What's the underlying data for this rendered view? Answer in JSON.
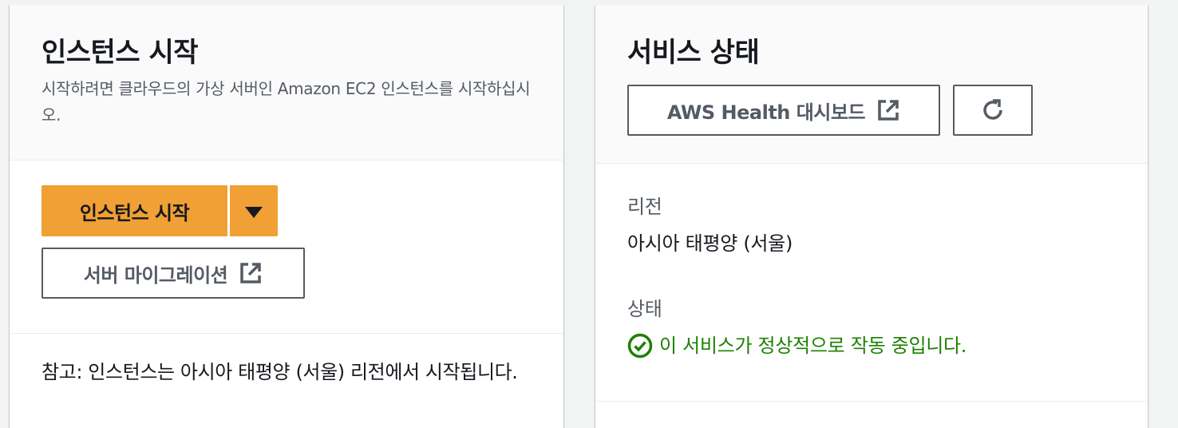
{
  "launch": {
    "title": "인스턴스 시작",
    "description": "시작하려면 클라우드의 가상 서버인 Amazon EC2 인스턴스를 시작하십시오.",
    "launch_button_label": "인스턴스 시작",
    "migration_button_label": "서버 마이그레이션",
    "note": "참고: 인스턴스는 아시아 태평양 (서울) 리전에서 시작됩니다."
  },
  "health": {
    "title": "서비스 상태",
    "dashboard_button_label": "AWS Health 대시보드",
    "region_label": "리전",
    "region_value": "아시아 태평양 (서울)",
    "status_label": "상태",
    "status_value": "이 서비스가 정상적으로 작동 중입니다."
  },
  "icons": {
    "dropdown": "caret-down-icon",
    "external": "external-link-icon",
    "refresh": "refresh-icon",
    "status": "check-circle-icon"
  },
  "colors": {
    "primary_button": "#f0a034",
    "success": "#1d8102",
    "secondary_text": "#545b64"
  }
}
